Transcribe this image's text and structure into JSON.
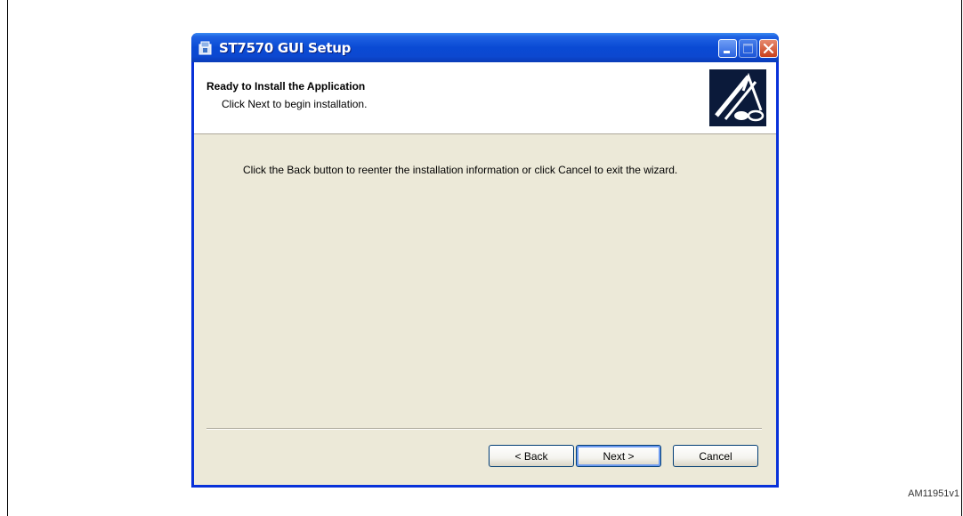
{
  "window": {
    "title": "ST7570 GUI Setup",
    "header_title": "Ready to Install the Application",
    "header_subtitle": "Click Next to begin installation.",
    "body_text": "Click the Back button to reenter the installation information or click Cancel to exit the wizard."
  },
  "buttons": {
    "back": "< Back",
    "next": "Next >",
    "cancel": "Cancel"
  },
  "figure_id": "AM11951v1",
  "icons": {
    "app": "setup-icon",
    "header": "installer-logo-icon",
    "minimize": "minimize-icon",
    "maximize": "maximize-icon",
    "close": "close-icon"
  },
  "colors": {
    "titlebar": "#0a4ad4",
    "dialog_bg": "#ece9d8",
    "close_button": "#c8401c"
  }
}
